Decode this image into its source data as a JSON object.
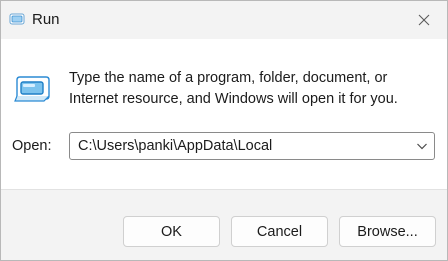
{
  "window": {
    "title": "Run",
    "close_icon": "close-icon"
  },
  "main": {
    "icon": "run-dialog-icon",
    "description": "Type the name of a program, folder, document, or Internet resource, and Windows will open it for you.",
    "open_label": "Open:",
    "open_value": "C:\\Users\\panki\\AppData\\Local"
  },
  "buttons": {
    "ok_label": "OK",
    "cancel_label": "Cancel",
    "browse_label": "Browse..."
  },
  "colors": {
    "accent": "#1e90d6",
    "titlebar_bg": "#f3f3f3",
    "footer_bg": "#f3f3f3"
  }
}
